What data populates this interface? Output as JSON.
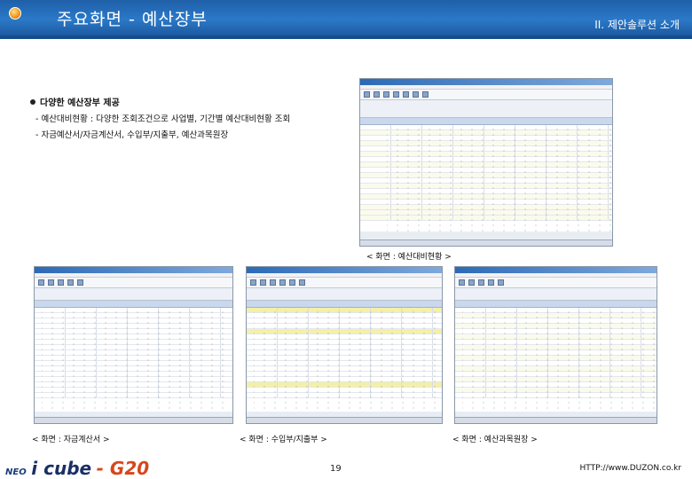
{
  "header": {
    "title": "주요화면 - 예산장부",
    "section": "II. 제안솔루션 소개"
  },
  "feature": {
    "heading": "다양한 예산장부 제공",
    "lines": [
      "- 예산대비현황 : 다양한 조회조건으로 사업별, 기간별 예산대비현황 조회",
      "- 자금예산서/자금계산서, 수입부/지출부, 예산과목원장"
    ]
  },
  "captions": {
    "budget_comparison": "< 화면 : 예산대비현황 >",
    "fund_statement": "< 화면 : 자금계산서 >",
    "income_expense": "< 화면 : 수입부/지출부 >",
    "budget_ledger": "< 화면 : 예산과목원장 >"
  },
  "footer": {
    "logo_neo": "NEO",
    "logo_icube": "i cube",
    "logo_g20": "- G20",
    "page_number": "19",
    "url": "HTTP://www.DUZON.co.kr"
  },
  "colors": {
    "header_blue": "#2b79c8",
    "logo_orange": "#d8461c"
  }
}
